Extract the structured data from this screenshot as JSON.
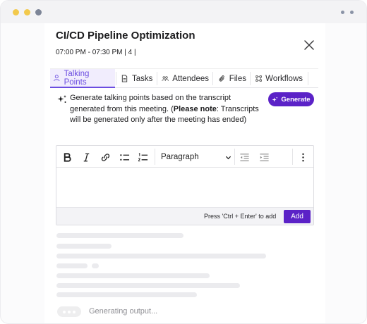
{
  "meeting": {
    "title": "CI/CD Pipeline Optimization",
    "details": "07:00 PM - 07:30 PM | 4 |"
  },
  "tabs": [
    {
      "label": "Talking Points",
      "icon": "person-icon",
      "active": true
    },
    {
      "label": "Tasks",
      "icon": "document-icon",
      "active": false
    },
    {
      "label": "Attendees",
      "icon": "people-icon",
      "active": false
    },
    {
      "label": "Files",
      "icon": "paperclip-icon",
      "active": false
    },
    {
      "label": "Workflows",
      "icon": "workflow-icon",
      "active": false
    }
  ],
  "generate": {
    "text_main": "Generate talking points based on the transcript generated from this meeting. (",
    "note_label": "Please note",
    "text_note": ": Transcripts will be generated only after the meeting has ended)",
    "button_label": "Generate"
  },
  "editor": {
    "format_select": "Paragraph",
    "hint": "Press 'Ctrl + Enter' to add",
    "add_label": "Add"
  },
  "status": {
    "generating": "Generating output..."
  },
  "colors": {
    "accent": "#5b22c7",
    "tab_active": "#6b4de0"
  }
}
